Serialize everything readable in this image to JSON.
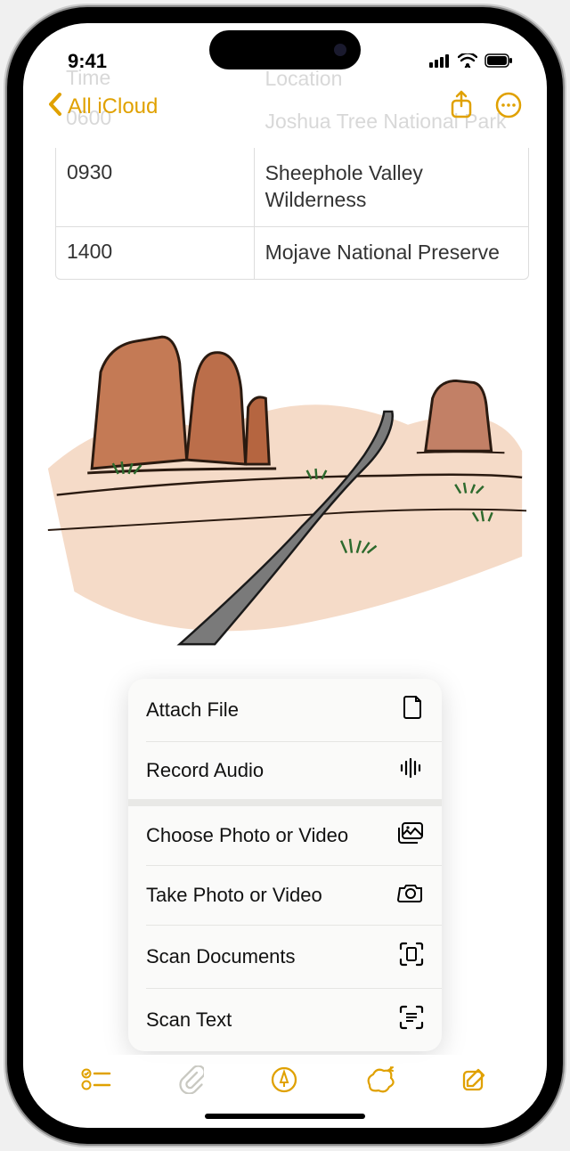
{
  "status": {
    "time": "9:41"
  },
  "nav": {
    "back_label": "All iCloud"
  },
  "faded": {
    "header_time": "Time",
    "header_loc": "Location",
    "r0_time": "0600",
    "r0_loc": "Joshua Tree National Park"
  },
  "table": {
    "rows": [
      {
        "time": "0930",
        "loc": "Sheephole Valley Wilderness"
      },
      {
        "time": "1400",
        "loc": "Mojave National Preserve"
      }
    ]
  },
  "popup": {
    "attach_file": "Attach File",
    "record_audio": "Record Audio",
    "choose_photo": "Choose Photo or Video",
    "take_photo": "Take Photo or Video",
    "scan_docs": "Scan Documents",
    "scan_text": "Scan Text"
  }
}
